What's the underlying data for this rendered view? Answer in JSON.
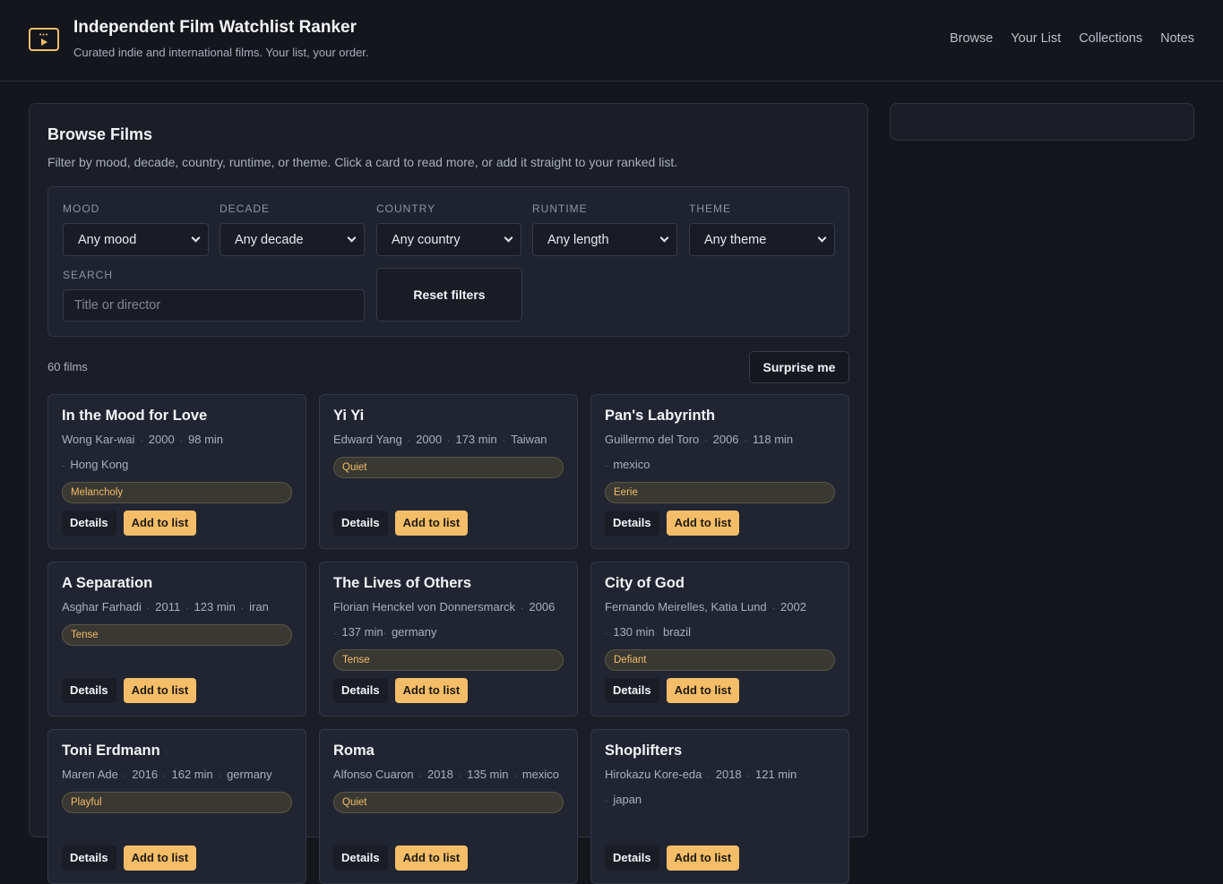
{
  "header": {
    "title": "Independent Film Watchlist Ranker",
    "subtitle": "Curated indie and international films. Your list, your order.",
    "logo_icon": "film-screen-icon",
    "nav": [
      "Browse",
      "Your List",
      "Collections",
      "Notes"
    ]
  },
  "browse": {
    "title": "Browse Films",
    "description": "Filter by mood, decade, country, runtime, or theme. Click a card to read more, or add it straight to your ranked list.",
    "filters": {
      "mood": {
        "label": "MOOD",
        "value": "Any mood"
      },
      "decade": {
        "label": "DECADE",
        "value": "Any decade"
      },
      "country": {
        "label": "COUNTRY",
        "value": "Any country"
      },
      "runtime": {
        "label": "RUNTIME",
        "value": "Any length"
      },
      "theme": {
        "label": "THEME",
        "value": "Any theme"
      },
      "search": {
        "label": "SEARCH",
        "placeholder": "Title or director"
      },
      "reset_label": "Reset filters"
    },
    "count": "60 films",
    "surprise_label": "Surprise me",
    "card_details_label": "Details",
    "card_add_label": "Add to list"
  },
  "films": [
    {
      "title": "In the Mood for Love",
      "meta": [
        "Wong Kar-wai",
        "2000",
        "98 min"
      ],
      "meta2": [
        "Hong Kong"
      ],
      "tag": "Melancholy"
    },
    {
      "title": "Yi Yi",
      "meta": [
        "Edward Yang",
        "2000",
        "173 min",
        "Taiwan"
      ],
      "meta2": [],
      "tag": "Quiet"
    },
    {
      "title": "Pan's Labyrinth",
      "meta": [
        "Guillermo del Toro",
        "2006",
        "118 min"
      ],
      "meta2": [
        "mexico"
      ],
      "tag": "Eerie"
    },
    {
      "title": "A Separation",
      "meta": [
        "Asghar Farhadi",
        "2011",
        "123 min",
        "iran"
      ],
      "meta2": [],
      "tag": "Tense"
    },
    {
      "title": "The Lives of Others",
      "meta": [
        "Florian Henckel von Donnersmarck",
        "2006"
      ],
      "meta2": [
        "137 min",
        "germany"
      ],
      "tag": "Tense"
    },
    {
      "title": "City of God",
      "meta": [
        "Fernando Meirelles, Katia Lund",
        "2002"
      ],
      "meta2": [
        "130 min",
        "brazil"
      ],
      "tag": "Defiant"
    },
    {
      "title": "Toni Erdmann",
      "meta": [
        "Maren Ade",
        "2016",
        "162 min",
        "germany"
      ],
      "meta2": [],
      "tag": "Playful"
    },
    {
      "title": "Roma",
      "meta": [
        "Alfonso Cuaron",
        "2018",
        "135 min",
        "mexico"
      ],
      "meta2": [],
      "tag": "Quiet"
    },
    {
      "title": "Shoplifters",
      "meta": [
        "Hirokazu Kore-eda",
        "2018",
        "121 min"
      ],
      "meta2": [
        "japan"
      ],
      "tag": ""
    }
  ]
}
